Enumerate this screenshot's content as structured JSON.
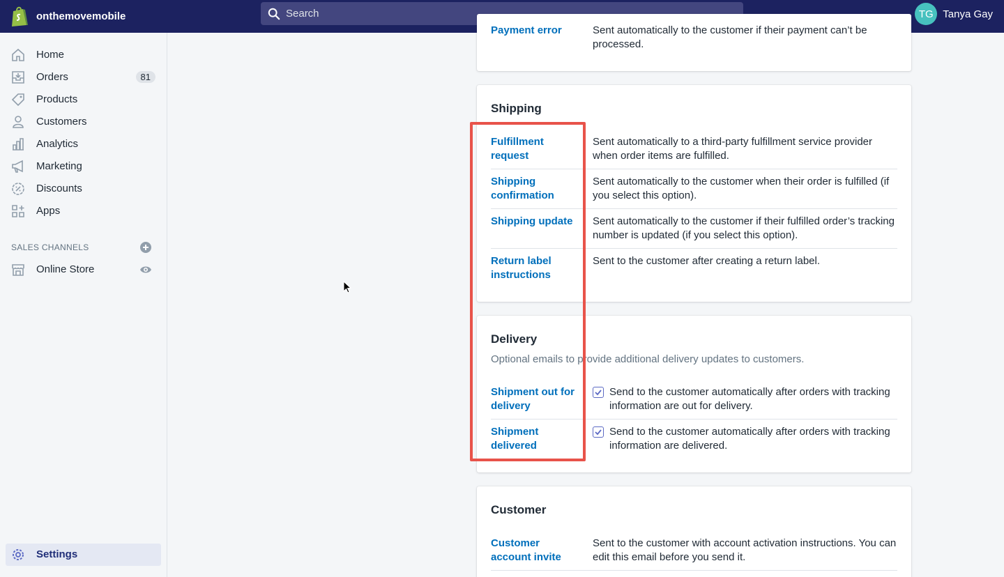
{
  "topbar": {
    "store_name": "onthemovemobile",
    "search_placeholder": "Search",
    "user": {
      "initials": "TG",
      "name": "Tanya Gay"
    },
    "colors": {
      "bar": "#1c2260",
      "avatar": "#47c1bf"
    }
  },
  "sidebar": {
    "items": [
      {
        "label": "Home",
        "icon": "home-icon"
      },
      {
        "label": "Orders",
        "icon": "orders-icon",
        "badge": "81"
      },
      {
        "label": "Products",
        "icon": "tag-icon"
      },
      {
        "label": "Customers",
        "icon": "person-icon"
      },
      {
        "label": "Analytics",
        "icon": "bar-chart-icon"
      },
      {
        "label": "Marketing",
        "icon": "megaphone-icon"
      },
      {
        "label": "Discounts",
        "icon": "discount-icon"
      },
      {
        "label": "Apps",
        "icon": "apps-icon"
      }
    ],
    "sales_channels_title": "SALES CHANNELS",
    "online_store": "Online Store",
    "settings": "Settings"
  },
  "payment_card": {
    "link": "Payment error",
    "desc": "Sent automatically to the customer if their payment can’t be processed."
  },
  "shipping": {
    "title": "Shipping",
    "rows": [
      {
        "link": "Fulfillment request",
        "desc": "Sent automatically to a third-party fulfillment service provider when order items are fulfilled."
      },
      {
        "link": "Shipping confirmation",
        "desc": "Sent automatically to the customer when their order is fulfilled (if you select this option)."
      },
      {
        "link": "Shipping update",
        "desc": "Sent automatically to the customer if their fulfilled order’s tracking number is updated (if you select this option)."
      },
      {
        "link": "Return label instructions",
        "desc": "Sent to the customer after creating a return label."
      }
    ]
  },
  "delivery": {
    "title": "Delivery",
    "subtitle": "Optional emails to provide additional delivery updates to customers.",
    "rows": [
      {
        "link": "Shipment out for delivery",
        "desc": "Send to the customer automatically after orders with tracking information are out for delivery.",
        "checked": true
      },
      {
        "link": "Shipment delivered",
        "desc": "Send to the customer automatically after orders with tracking information are delivered.",
        "checked": true
      }
    ]
  },
  "customer": {
    "title": "Customer",
    "rows": [
      {
        "link": "Customer account invite",
        "desc": "Sent to the customer with account activation instructions. You can edit this email before you send it."
      }
    ]
  },
  "highlight_color": "#e8534a"
}
